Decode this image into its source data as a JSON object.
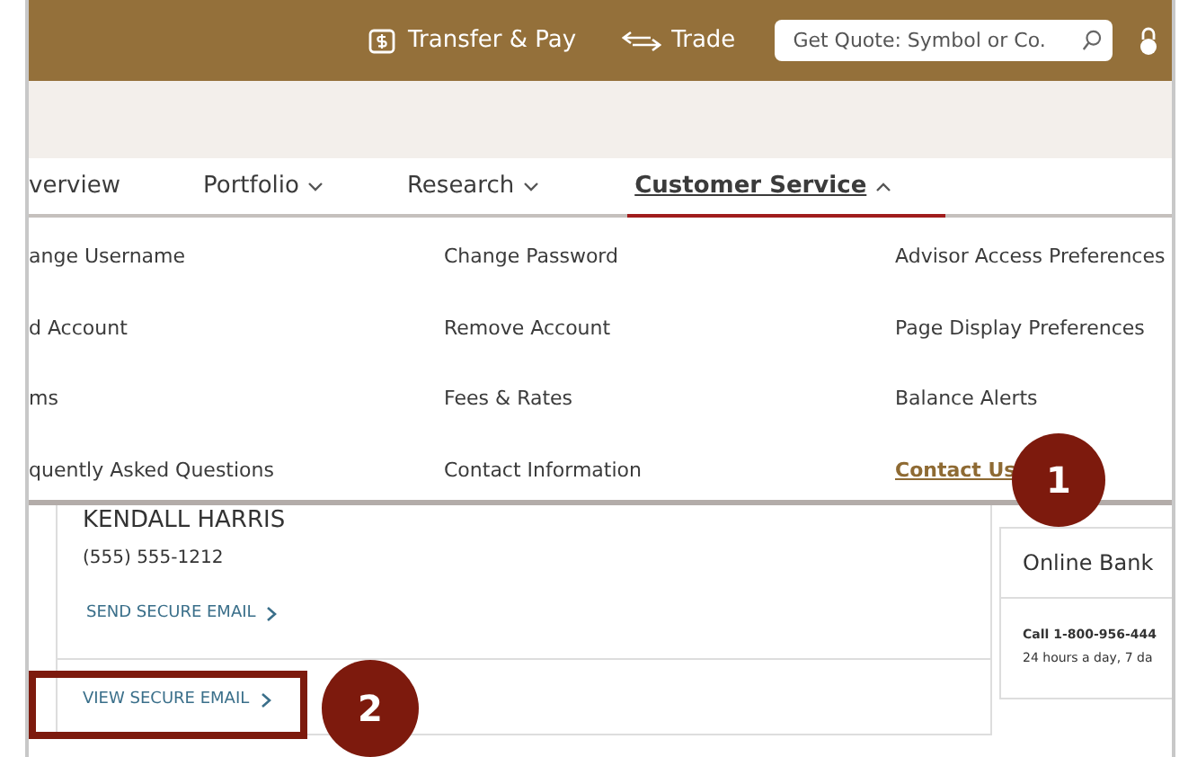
{
  "top_bar": {
    "transfer_pay": "Transfer & Pay",
    "trade": "Trade",
    "search": {
      "placeholder": "Get Quote: Symbol or Co."
    }
  },
  "nav": {
    "tabs": [
      {
        "label": "verview",
        "selected": false,
        "caret": false
      },
      {
        "label": "Portfolio",
        "selected": false,
        "caret": true
      },
      {
        "label": "Research",
        "selected": false,
        "caret": true
      },
      {
        "label": "Customer Service",
        "selected": true,
        "caret": true
      }
    ]
  },
  "menu": {
    "columns": [
      [
        {
          "label": "ange Username",
          "highlighted": false
        },
        {
          "label": "d Account",
          "highlighted": false
        },
        {
          "label": "ms",
          "highlighted": false
        },
        {
          "label": "quently Asked Questions",
          "highlighted": false
        }
      ],
      [
        {
          "label": "Change Password",
          "highlighted": false
        },
        {
          "label": "Remove Account",
          "highlighted": false
        },
        {
          "label": "Fees & Rates",
          "highlighted": false
        },
        {
          "label": "Contact Information",
          "highlighted": false
        }
      ],
      [
        {
          "label": "Advisor Access Preferences",
          "highlighted": false
        },
        {
          "label": "Page Display Preferences",
          "highlighted": false
        },
        {
          "label": "Balance Alerts",
          "highlighted": false
        },
        {
          "label": "Contact Us",
          "highlighted": true
        }
      ]
    ]
  },
  "advisor_card": {
    "name": "KENDALL HARRIS",
    "phone": "(555) 555-1212",
    "send_link": "SEND SECURE EMAIL",
    "view_link": "VIEW SECURE EMAIL"
  },
  "online_banking_card": {
    "title": "Online Bank",
    "phone_line": "Call 1-800-956-444",
    "hours": "24 hours a day, 7 da"
  },
  "annotations": [
    {
      "label": "1"
    },
    {
      "label": "2"
    }
  ]
}
